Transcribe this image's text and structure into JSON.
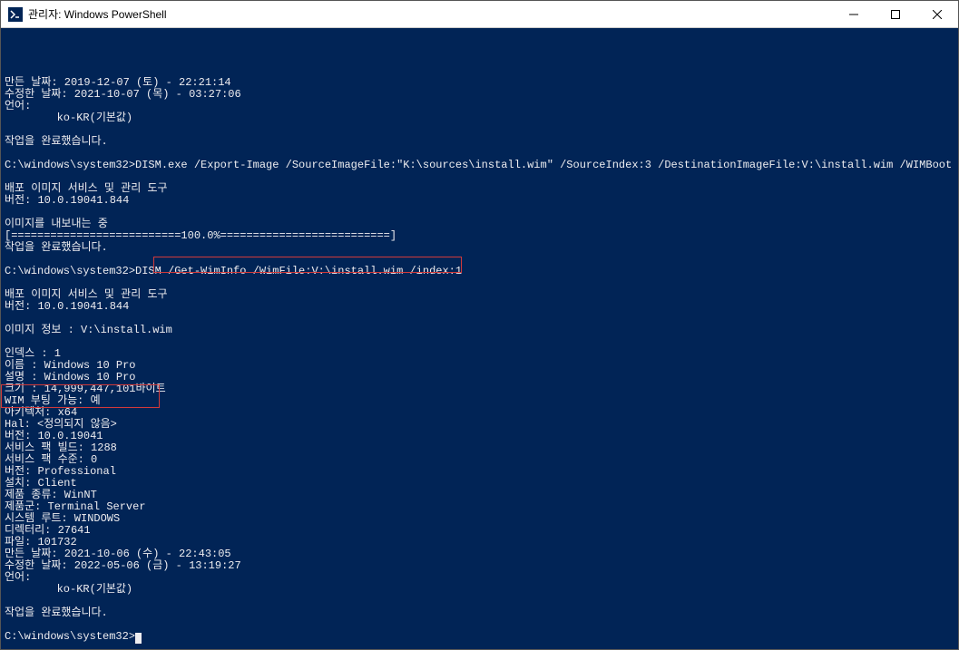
{
  "window": {
    "title": "관리자: Windows PowerShell"
  },
  "terminal": {
    "lines": [
      "만든 날짜: 2019-12-07 (토) - 22:21:14",
      "수정한 날짜: 2021-10-07 (목) - 03:27:06",
      "언어:",
      "        ko-KR(기본값)",
      "",
      "작업을 완료했습니다.",
      "",
      "C:\\windows\\system32>DISM.exe /Export-Image /SourceImageFile:\"K:\\sources\\install.wim\" /SourceIndex:3 /DestinationImageFile:V:\\install.wim /WIMBoot",
      "",
      "배포 이미지 서비스 및 관리 도구",
      "버전: 10.0.19041.844",
      "",
      "이미지를 내보내는 중",
      "[==========================100.0%==========================]",
      "작업을 완료했습니다.",
      "",
      "C:\\windows\\system32>DISM /Get-WimInfo /WimFile:V:\\install.wim /index:1",
      "",
      "배포 이미지 서비스 및 관리 도구",
      "버전: 10.0.19041.844",
      "",
      "이미지 정보 : V:\\install.wim",
      "",
      "인덱스 : 1",
      "이름 : Windows 10 Pro",
      "설명 : Windows 10 Pro",
      "크기 : 14,999,447,101바이트",
      "WIM 부팅 가능: 예",
      "아키텍처: x64",
      "Hal: <정의되지 않음>",
      "버전: 10.0.19041",
      "서비스 팩 빌드: 1288",
      "서비스 팩 수준: 0",
      "버전: Professional",
      "설치: Client",
      "제품 종류: WinNT",
      "제품군: Terminal Server",
      "시스템 루트: WINDOWS",
      "디렉터리: 27641",
      "파일: 101732",
      "만든 날짜: 2021-10-06 (수) - 22:43:05",
      "수정한 날짜: 2022-05-06 (금) - 13:19:27",
      "언어:",
      "        ko-KR(기본값)",
      "",
      "작업을 완료했습니다.",
      "",
      "C:\\windows\\system32>"
    ],
    "prompt_cursor": true
  }
}
